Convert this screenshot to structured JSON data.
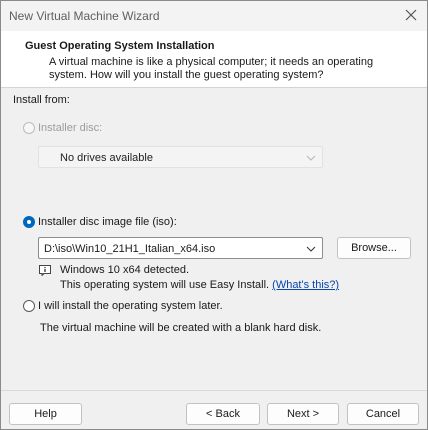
{
  "window": {
    "title": "New Virtual Machine Wizard"
  },
  "header": {
    "title": "Guest Operating System Installation",
    "description": "A virtual machine is like a physical computer; it needs an operating system. How will you install the guest operating system?"
  },
  "install_from": {
    "label": "Install from:",
    "disc_option": {
      "label": "Installer disc:",
      "selected": false,
      "enabled": false,
      "drive_value": "No drives available"
    },
    "iso_option": {
      "label": "Installer disc image file (iso):",
      "selected": true,
      "path": "D:\\iso\\Win10_21H1_Italian_x64.iso",
      "browse_label": "Browse...",
      "detected_text": "Windows 10 x64 detected.",
      "easy_install_text": "This operating system will use Easy Install.",
      "whats_this_link": "(What's this?)"
    },
    "later_option": {
      "label": "I will install the operating system later.",
      "selected": false,
      "description": "The virtual machine will be created with a blank hard disk."
    }
  },
  "footer": {
    "help": "Help",
    "back": "< Back",
    "next": "Next >",
    "cancel": "Cancel"
  }
}
